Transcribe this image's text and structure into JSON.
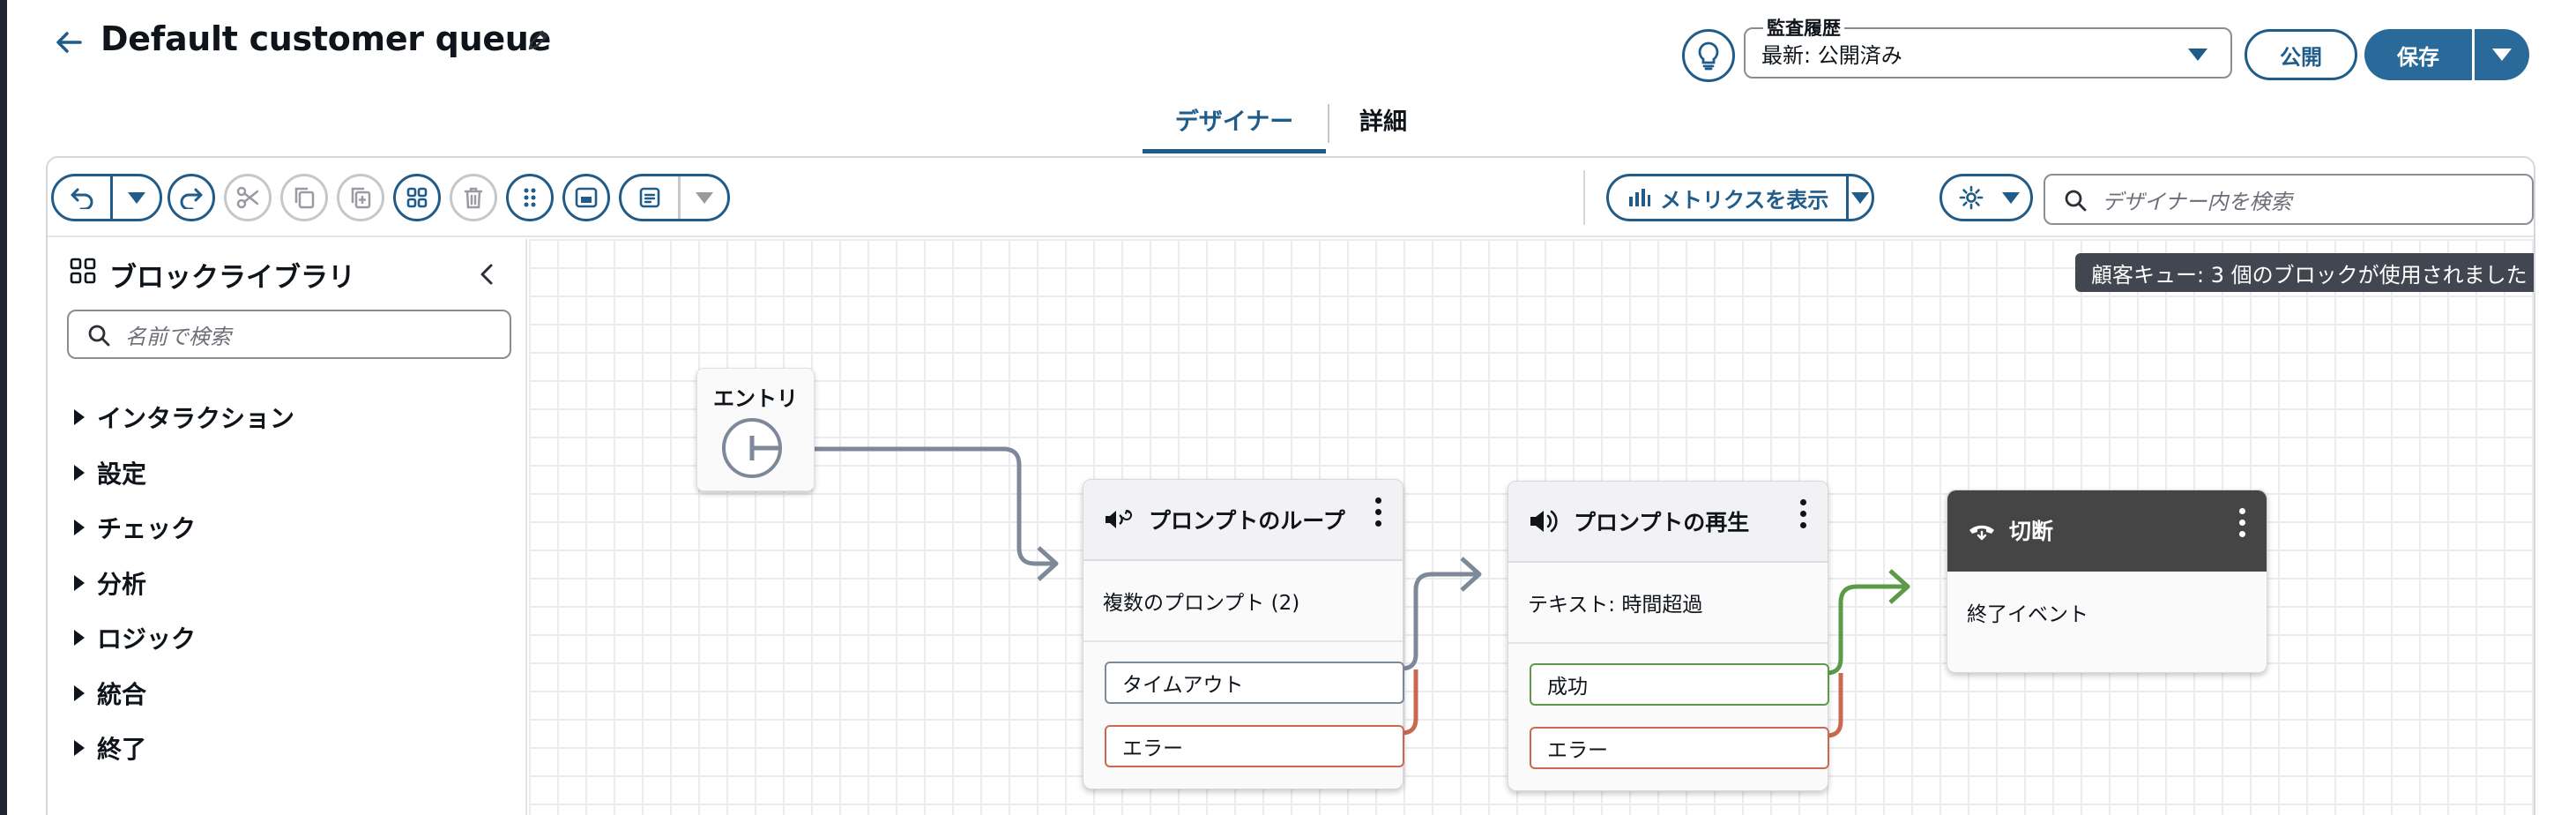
{
  "header": {
    "title": "Default customer queue",
    "audit_label": "監査履歴",
    "audit_value": "最新: 公開済み",
    "publish_label": "公開",
    "save_label": "保存"
  },
  "tabs": [
    {
      "label": "デザイナー",
      "active": true
    },
    {
      "label": "詳細",
      "active": false
    }
  ],
  "toolbar": {
    "metrics_label": "メトリクスを表示",
    "search_placeholder": "デザイナー内を検索"
  },
  "sidebar": {
    "title": "ブロックライブラリ",
    "search_placeholder": "名前で検索",
    "categories": [
      "インタラクション",
      "設定",
      "チェック",
      "分析",
      "ロジック",
      "統合",
      "終了"
    ]
  },
  "canvas": {
    "badge": "顧客キュー: 3 個のブロックが使用されました",
    "entry": {
      "label": "エントリ"
    },
    "blocks": [
      {
        "title": "プロンプトのループ",
        "icon": "speaker-loop-icon",
        "body": "複数のプロンプト (2)",
        "branches": [
          "タイムアウト",
          "エラー"
        ]
      },
      {
        "title": "プロンプトの再生",
        "icon": "speaker-icon",
        "body": "テキスト: 時間超過",
        "branches": [
          "成功",
          "エラー"
        ]
      },
      {
        "title": "切断",
        "icon": "hangup-icon",
        "body": "終了イベント",
        "branches": []
      }
    ]
  },
  "colors": {
    "accent": "#1f5c8a",
    "connector_neutral": "#7d8998",
    "connector_success": "#5c9a48",
    "connector_error": "#c96a50",
    "dark_header": "#454545"
  }
}
